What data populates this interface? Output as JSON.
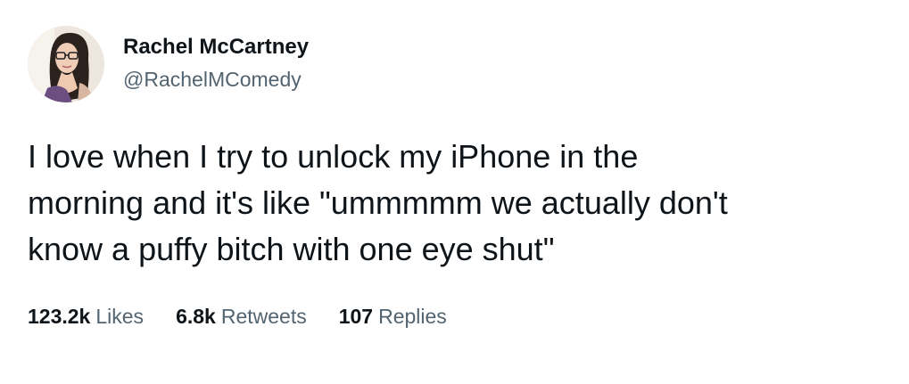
{
  "author": {
    "display_name": "Rachel McCartney",
    "handle": "@RachelMComedy",
    "avatar_icon": "profile-photo"
  },
  "tweet": {
    "text": "I love when I try to unlock my iPhone in the\nmorning and it's like \"ummmmm we actually don't\nknow a puffy bitch with one eye shut\""
  },
  "stats": {
    "likes_count": "123.2k",
    "likes_label": "Likes",
    "retweets_count": "6.8k",
    "retweets_label": "Retweets",
    "replies_count": "107",
    "replies_label": "Replies"
  },
  "colors": {
    "primary_text": "#0f1419",
    "secondary_text": "#536471",
    "background": "#ffffff"
  }
}
